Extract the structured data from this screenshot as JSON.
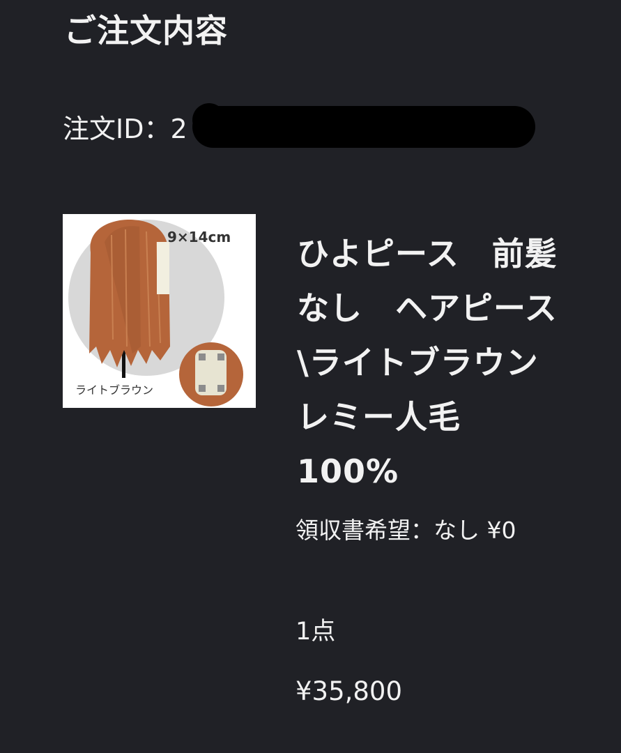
{
  "page": {
    "title": "ご注文内容"
  },
  "order": {
    "id_label": "注文ID：",
    "id_visible_prefix": "2"
  },
  "product": {
    "image": {
      "size_label": "9×14cm",
      "color_caption": "ライトブラウン",
      "hair_color": "#b5653a",
      "background_color": "#d7d7d7"
    },
    "name": "ひよピース　前髪なし　ヘアピース \\ライトブラウン　レミー人毛100%",
    "receipt_option": "領収書希望：なし ¥0",
    "quantity": "1点",
    "price": "¥35,800"
  },
  "colors": {
    "background": "#202126",
    "text": "#f2f2f2",
    "redaction": "#000000"
  }
}
